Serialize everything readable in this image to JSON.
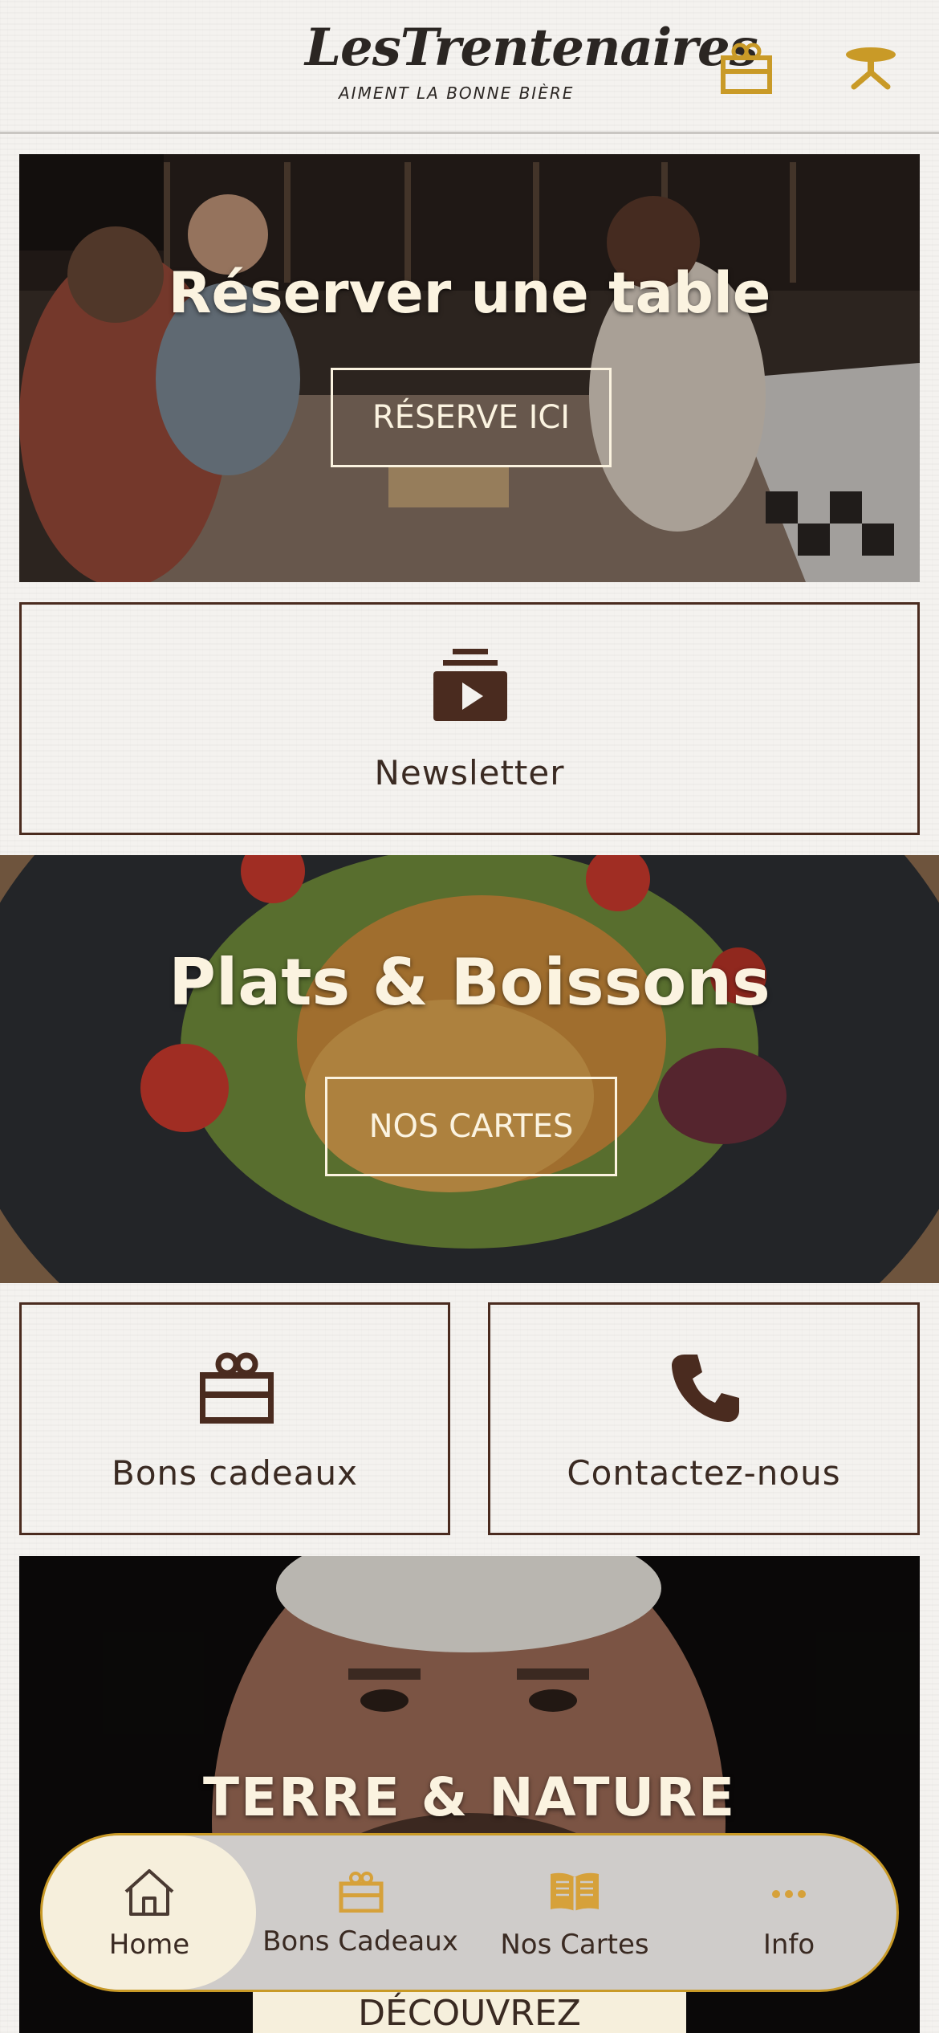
{
  "header": {
    "logo_script": "LesTrentenaires",
    "logo_tagline": "AIMENT LA BONNE BIÈRE",
    "icons": [
      "gift-icon",
      "table-icon"
    ]
  },
  "reserve": {
    "title": "Réserver une table",
    "button": "RÉSERVE ICI"
  },
  "newsletter": {
    "label": "Newsletter",
    "icon": "video-stack-icon"
  },
  "menu": {
    "title": "Plats & Boissons",
    "button": "NOS CARTES"
  },
  "gift": {
    "label": "Bons cadeaux",
    "icon": "gift-icon"
  },
  "contact": {
    "label": "Contactez-nous",
    "icon": "phone-icon"
  },
  "terre": {
    "title": "TERRE & NATURE",
    "button": "DÉCOUVREZ"
  },
  "nav": {
    "items": [
      {
        "label": "Home",
        "icon": "home-icon",
        "active": true
      },
      {
        "label": "Bons Cadeaux",
        "icon": "gift-icon",
        "active": false
      },
      {
        "label": "Nos Cartes",
        "icon": "book-icon",
        "active": false
      },
      {
        "label": "Info",
        "icon": "more-icon",
        "active": false
      }
    ]
  },
  "colors": {
    "accent": "#c99a27",
    "brown": "#4a2b1f",
    "cream": "#fbf3e0"
  }
}
